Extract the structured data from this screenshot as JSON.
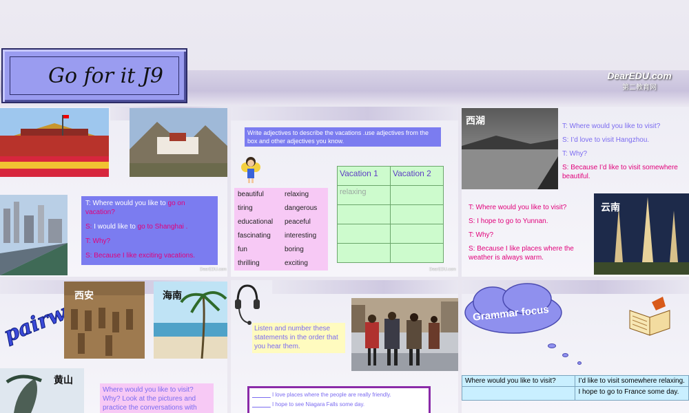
{
  "header": {
    "title": "Go for it J9",
    "logo_en": "DearEDU.com",
    "logo_zh": "第二教育网"
  },
  "panel1": {
    "dialog": [
      {
        "a": "T: Where ",
        "b": "would you like to ",
        "c": "go on vacation?"
      },
      {
        "a": "S: ",
        "b": "I would like to ",
        "c": "go to Shanghai ."
      },
      {
        "a": "T: Why?",
        "b": "",
        "c": ""
      },
      {
        "a": "S: Because I like exciting vacations.",
        "b": "",
        "c": ""
      }
    ],
    "watermark": "DearEDU.com"
  },
  "panel2": {
    "instruction": "Write adjectives to describe the vacations .use adjectives from the box and other adjectives you know.",
    "adjectives": [
      [
        "beautiful",
        "relaxing"
      ],
      [
        "tiring",
        "dangerous"
      ],
      [
        "educational",
        "peaceful"
      ],
      [
        "fascinating",
        "interesting"
      ],
      [
        "fun",
        "boring"
      ],
      [
        "thrilling",
        "exciting"
      ]
    ],
    "table_headers": [
      "Vacation 1",
      "Vacation 2"
    ],
    "table_example": "relaxing",
    "watermark": "DearEDU.com"
  },
  "panel3": {
    "label_top": "西湖",
    "label_bottom": "云南",
    "dialog_top": [
      "T: Where would you like to visit?",
      "S: I’d love to visit Hangzhou.",
      "T: Why?",
      "S: Because I’d like to visit somewhere beautiful."
    ],
    "dialog_bottom": [
      "T: Where would you like to visit?",
      "S: I hope to go to Yunnan.",
      "T: Why?",
      "S: Because I like places where the weather is always warm."
    ]
  },
  "panel4": {
    "pairwork": "pairwork",
    "labels": [
      "西安",
      "海南",
      "黄山"
    ],
    "prompt": "Where would you like to visit? Why? Look  at the pictures and practice the conversations with"
  },
  "panel5": {
    "instruction": "Listen and number these statements in the order that you hear them.",
    "statements": [
      "I love places where the people are really friendly.",
      "I hope to see Niagara Falls some day."
    ],
    "blank": "______"
  },
  "panel6": {
    "cloud_text": "Grammar focus",
    "table": [
      [
        "Where would you like to visit?",
        "I’d like to visit somewhere relaxing."
      ],
      [
        "",
        "I hope to go to France some day."
      ]
    ]
  }
}
